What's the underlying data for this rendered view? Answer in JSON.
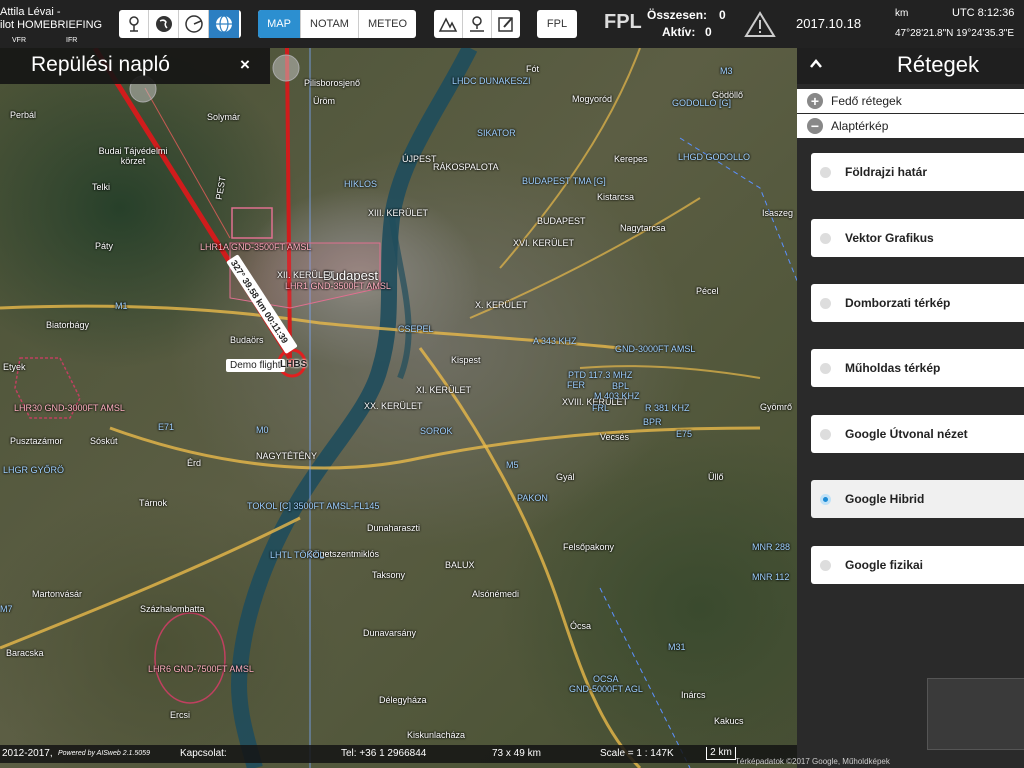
{
  "user": {
    "line1": "Attila Lévai -",
    "line2": "ilot HOMEBRIEFING",
    "vfr": "VFR",
    "ifr": "IFR"
  },
  "toolbar": {
    "tools": [
      {
        "icon": "route-tool-icon"
      },
      {
        "icon": "globe-icon"
      },
      {
        "icon": "compass-icon"
      },
      {
        "icon": "world-grid-icon"
      }
    ],
    "tabs": [
      "MAP",
      "NOTAM",
      "METEO"
    ],
    "active_tab": "MAP",
    "edit_tools": [
      {
        "icon": "airspace-icon"
      },
      {
        "icon": "waypoint-icon"
      },
      {
        "icon": "edit-icon"
      }
    ],
    "fpl_button": "FPL",
    "fpl_title": "FPL",
    "total_label": "Összesen:",
    "total_value": "0",
    "active_label": "Aktív:",
    "active_value": "0",
    "date": "2017.10.18",
    "unit": "km",
    "utc": "UTC 8:12:36",
    "coords": "47°28'21.8\"N 19°24'35.3\"E"
  },
  "flight_log": {
    "title": "Repülési napló",
    "close": "×"
  },
  "layers_panel": {
    "title": "Rétegek",
    "overlay_group": "Fedő rétegek",
    "base_group": "Alaptérkép",
    "options": [
      {
        "label": "Földrajzi határ",
        "selected": false
      },
      {
        "label": "Vektor Grafikus",
        "selected": false
      },
      {
        "label": "Domborzati térkép",
        "selected": false
      },
      {
        "label": "Műholdas térkép",
        "selected": false
      },
      {
        "label": "Google Útvonal nézet",
        "selected": false
      },
      {
        "label": "Google Hibrid",
        "selected": true
      },
      {
        "label": "Google fizikai",
        "selected": false
      }
    ]
  },
  "map": {
    "city": "Budapest",
    "flight_label": "Demo flight",
    "airport": "LHBS",
    "route_label": "327° 39.58 km 00:11:39",
    "labels": [
      {
        "text": "Budai Tájvédelmi körzet"
      },
      {
        "text": "Solymár"
      },
      {
        "text": "Perbál"
      },
      {
        "text": "Telki"
      },
      {
        "text": "Páty"
      },
      {
        "text": "Biatorbágy"
      },
      {
        "text": "Etyek"
      },
      {
        "text": "Budaörs"
      },
      {
        "text": "Pusztazámor"
      },
      {
        "text": "Sóskút"
      },
      {
        "text": "Érd"
      },
      {
        "text": "Tárnok"
      },
      {
        "text": "Martonvásár"
      },
      {
        "text": "Százhalombatta"
      },
      {
        "text": "Baracska"
      },
      {
        "text": "Ercsi"
      },
      {
        "text": "Szigetszentmiklós"
      },
      {
        "text": "Dunaharaszti"
      },
      {
        "text": "Taksony"
      },
      {
        "text": "Dunavarsány"
      },
      {
        "text": "Délegyháza"
      },
      {
        "text": "Kiskunlacháza"
      },
      {
        "text": "Alsónémedi"
      },
      {
        "text": "Ócsa"
      },
      {
        "text": "Inárcs"
      },
      {
        "text": "Kakucs"
      },
      {
        "text": "Felsőpakony"
      },
      {
        "text": "Gyál"
      },
      {
        "text": "Vecsés"
      },
      {
        "text": "Üllő"
      },
      {
        "text": "Gyömrő"
      },
      {
        "text": "Pécel"
      },
      {
        "text": "Isaszeg"
      },
      {
        "text": "Nagytarcsa"
      },
      {
        "text": "Kistarcsa"
      },
      {
        "text": "Kerepes"
      },
      {
        "text": "Mogyoród"
      },
      {
        "text": "Gödöllő"
      },
      {
        "text": "Fót"
      },
      {
        "text": "Üröm"
      },
      {
        "text": "Pilisborosjenő"
      },
      {
        "text": "Kispest"
      },
      {
        "text": "XII. KERÜLET"
      },
      {
        "text": "XIII. KERÜLET"
      },
      {
        "text": "XVI. KERÜLET"
      },
      {
        "text": "X. KERÜLET"
      },
      {
        "text": "XVIII. KERÜLET"
      },
      {
        "text": "XX. KERÜLET"
      },
      {
        "text": "XI. KERÜLET"
      },
      {
        "text": "BUDAPEST"
      },
      {
        "text": "PEST"
      },
      {
        "text": "RÁKOSPALOTA"
      },
      {
        "text": "ÚJPEST"
      },
      {
        "text": "BALUX"
      }
    ],
    "airspace_labels": [
      {
        "text": "LHR1A GND-3500FT AMSL"
      },
      {
        "text": "LHR1 GND-3500FT AMSL"
      },
      {
        "text": "LHR30 GND-3000FT AMSL"
      },
      {
        "text": "LHR6 GND-7500FT AMSL"
      },
      {
        "text": "TOKOL [C] 3500FT AMSL-FL145"
      },
      {
        "text": "GND-5000FT AGL"
      },
      {
        "text": "GND-3000FT AMSL"
      },
      {
        "text": "LHDC DUNAKESZI"
      },
      {
        "text": "GODOLLO [G]"
      },
      {
        "text": "BUDAPEST TMA [G]"
      },
      {
        "text": "SIKATOR"
      },
      {
        "text": "A 343 KHZ"
      },
      {
        "text": "PTD 117.3 MHZ"
      },
      {
        "text": "FER"
      },
      {
        "text": "BPL"
      },
      {
        "text": "M 403 KHZ"
      },
      {
        "text": "FRL"
      },
      {
        "text": "R 381 KHZ"
      },
      {
        "text": "BPR"
      },
      {
        "text": "SOROK"
      },
      {
        "text": "PAKON"
      },
      {
        "text": "NAGYTÉTÉNY"
      },
      {
        "text": "CSEPEL"
      },
      {
        "text": "LHTL TÖKÖL"
      },
      {
        "text": "HIKLOS"
      },
      {
        "text": "LHGR GYŐRÖ"
      },
      {
        "text": "LHGD GODOLLO"
      },
      {
        "text": "OCSA"
      },
      {
        "text": "MNR 288"
      },
      {
        "text": "MNR 112"
      }
    ],
    "roads": [
      "M1",
      "M0",
      "M5",
      "M7",
      "E71",
      "E75",
      "M31",
      "M3"
    ]
  },
  "bottom": {
    "copyright": "2012-2017,",
    "powered": "Powered by AISweb 2.1.5059",
    "contact": "Kapcsolat:",
    "tel": "Tel: +36 1 2966844",
    "size": "73 x 49 km",
    "scale": "Scale = 1 : 147K",
    "scalebar": "2 km",
    "credits": "Térképadatok ©2017 Google, Műholdképek"
  }
}
